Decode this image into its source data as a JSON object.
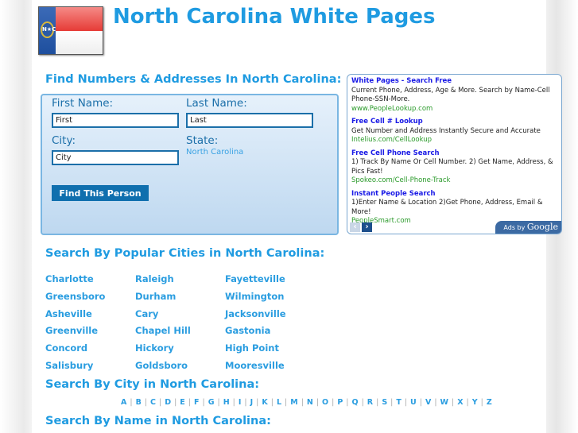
{
  "header": {
    "title": "North Carolina White Pages",
    "flag_seal": "N★C"
  },
  "search": {
    "heading": "Find Numbers & Addresses In North Carolina:",
    "first_label": "First Name:",
    "first_value": "First",
    "last_label": "Last Name:",
    "last_value": "Last",
    "city_label": "City:",
    "city_value": "City",
    "state_label": "State:",
    "state_value": "North Carolina",
    "button": "Find This Person"
  },
  "ads": {
    "items": [
      {
        "title": "White Pages - Search Free",
        "desc": "Current Phone, Address, Age & More. Search by Name-Cell Phone-SSN-More.",
        "url": "www.PeopleLookup.com"
      },
      {
        "title": "Free Cell # Lookup",
        "desc": "Get Number and Address Instantly Secure and Accurate",
        "url": "Intelius.com/CellLookup"
      },
      {
        "title": "Free Cell Phone Search",
        "desc": "1) Track By Name Or Cell Number. 2) Get Name, Address, & Pics Fast!",
        "url": "Spokeo.com/Cell-Phone-Track"
      },
      {
        "title": "Instant People Search",
        "desc": "1)Enter Name & Location 2)Get Phone, Address, Email & More!",
        "url": "PeopleSmart.com"
      }
    ],
    "prev": "‹",
    "next": "›",
    "ads_by": "Ads by",
    "google": "Google"
  },
  "popular": {
    "heading": "Search By Popular Cities in North Carolina:",
    "cities": [
      "Charlotte",
      "Raleigh",
      "Fayetteville",
      "Greensboro",
      "Durham",
      "Wilmington",
      "Asheville",
      "Cary",
      "Jacksonville",
      "Greenville",
      "Chapel Hill",
      "Gastonia",
      "Concord",
      "Hickory",
      "High Point",
      "Salisbury",
      "Goldsboro",
      "Mooresville"
    ]
  },
  "by_city": {
    "heading": "Search By City in North Carolina:",
    "letters": [
      "A",
      "B",
      "C",
      "D",
      "E",
      "F",
      "G",
      "H",
      "I",
      "J",
      "K",
      "L",
      "M",
      "N",
      "O",
      "P",
      "Q",
      "R",
      "S",
      "T",
      "U",
      "V",
      "W",
      "X",
      "Y",
      "Z"
    ]
  },
  "by_name": {
    "heading": "Search By Name in North Carolina:"
  },
  "colors": {
    "accent": "#1f9be1",
    "button": "#0f6fae",
    "ad_title": "#1a1ae6",
    "ad_url": "#2a9a2a"
  }
}
